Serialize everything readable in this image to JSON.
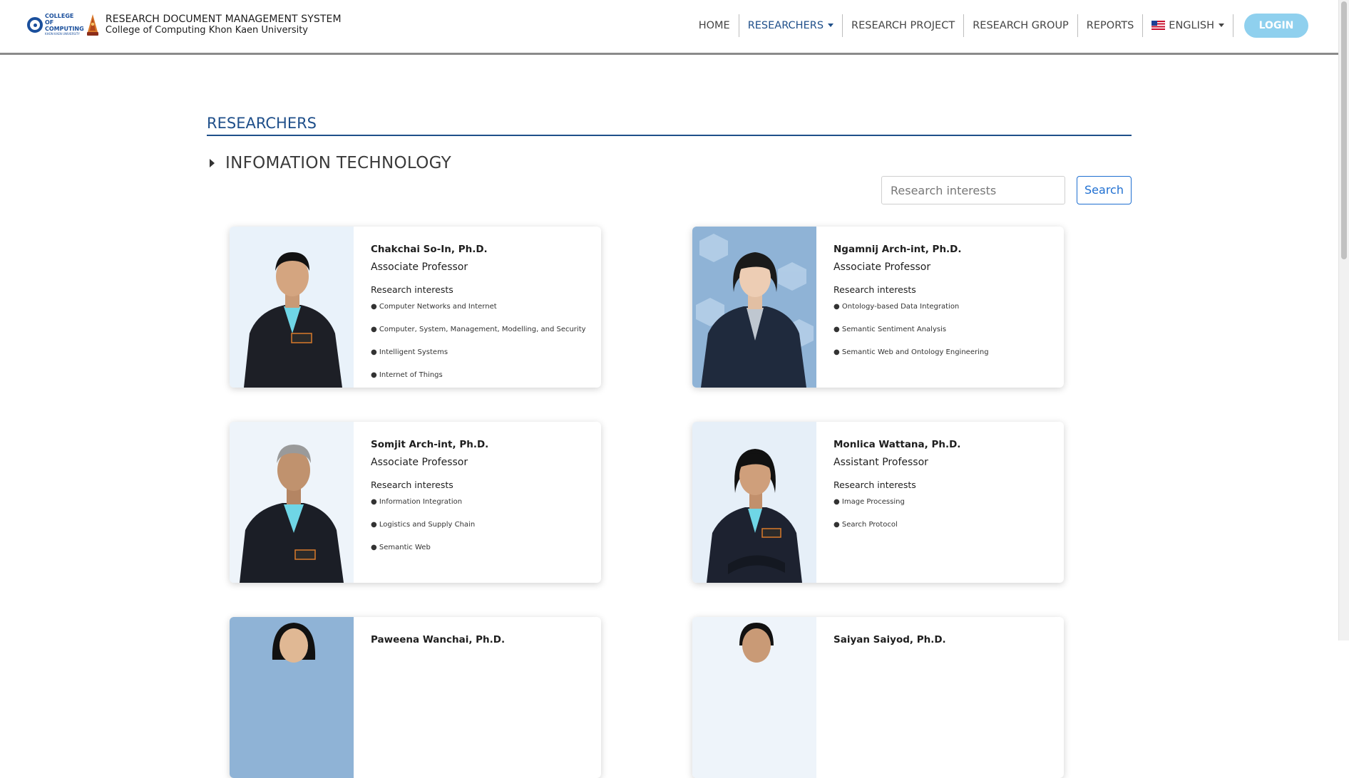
{
  "brand": {
    "logo_text": "COLLEGE OF COMPUTING",
    "logo_sub": "KHON KAEN UNIVERSITY",
    "title": "RESEARCH DOCUMENT MANAGEMENT SYSTEM",
    "subtitle": "College of Computing Khon Kaen University"
  },
  "nav": {
    "home": "HOME",
    "researchers": "RESEARCHERS",
    "research_project": "RESEARCH PROJECT",
    "research_group": "RESEARCH GROUP",
    "reports": "REPORTS",
    "language": "ENGLISH",
    "login": "LOGIN"
  },
  "page": {
    "title": "RESEARCHERS",
    "department": "INFOMATION TECHNOLOGY"
  },
  "search": {
    "placeholder": "Research interests",
    "button": "Search"
  },
  "researchers": [
    {
      "name": "Chakchai So-In, Ph.D.",
      "position": "Associate Professor",
      "interests_label": "Research interests",
      "interests": [
        "● Computer Networks and Internet",
        "● Computer, System, Management, Modelling, and Security",
        "● Intelligent Systems",
        "● Internet of Things"
      ]
    },
    {
      "name": "Ngamnij Arch-int, Ph.D.",
      "position": "Associate Professor",
      "interests_label": "Research interests",
      "interests": [
        "● Ontology-based Data Integration",
        "● Semantic Sentiment Analysis",
        "● Semantic Web and Ontology Engineering"
      ]
    },
    {
      "name": "Somjit Arch-int, Ph.D.",
      "position": "Associate Professor",
      "interests_label": "Research interests",
      "interests": [
        "● Information Integration",
        "● Logistics and Supply Chain",
        "● Semantic Web"
      ]
    },
    {
      "name": "Monlica Wattana, Ph.D.",
      "position": "Assistant Professor",
      "interests_label": "Research interests",
      "interests": [
        "● Image Processing",
        "● Search Protocol"
      ]
    },
    {
      "name": "Paweena Wanchai, Ph.D.",
      "position": "",
      "interests_label": "",
      "interests": []
    },
    {
      "name": "Saiyan Saiyod, Ph.D.",
      "position": "",
      "interests_label": "",
      "interests": []
    }
  ],
  "colors": {
    "accent": "#1f4f8a",
    "login_bg": "#8fd0ee",
    "search_border": "#1f6fd1"
  }
}
